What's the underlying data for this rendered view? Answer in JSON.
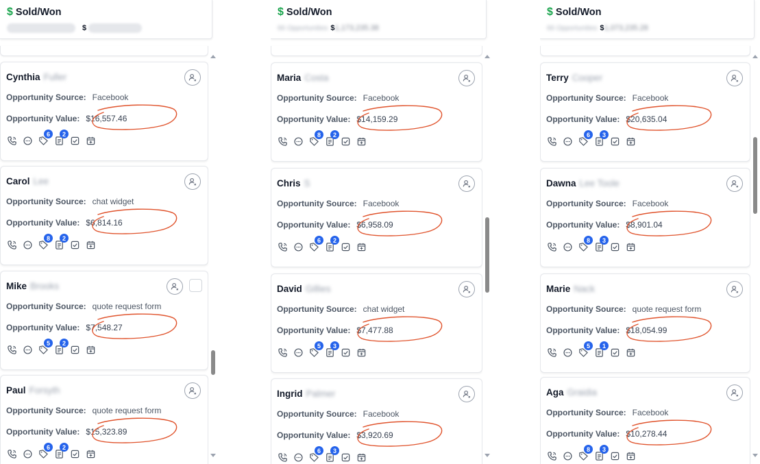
{
  "accent_color": "#2563eb",
  "annotation_color": "#e0532c",
  "labels": {
    "source": "Opportunity Source:",
    "value": "Opportunity Value:"
  },
  "columns": [
    {
      "title": "Sold/Won",
      "count_text": "",
      "amount_prefix": "$",
      "amount_blurred": "",
      "cards": [
        {
          "first_name": "Cynthia",
          "last_name": "Fuller",
          "source": "Facebook",
          "value": "$16,557.46",
          "badges": {
            "tasks": "6",
            "notes": "2"
          }
        },
        {
          "first_name": "Carol",
          "last_name": "Lee",
          "source": "chat widget",
          "value": "$6,814.16",
          "badges": {
            "tasks": "8",
            "notes": "2"
          }
        },
        {
          "first_name": "Mike",
          "last_name": "Brooks",
          "source": "quote request form",
          "value": "$7,548.27",
          "badges": {
            "tasks": "5",
            "notes": "2"
          }
        },
        {
          "first_name": "Paul",
          "last_name": "Forsyth",
          "source": "quote request form",
          "value": "$15,323.89",
          "badges": {
            "tasks": "6",
            "notes": "2"
          }
        }
      ]
    },
    {
      "title": "Sold/Won",
      "count_text": "66 Opportunities",
      "amount_prefix": "$",
      "amount_blurred": "1,173,235.38",
      "cards": [
        {
          "first_name": "Maria",
          "last_name": "Costa",
          "source": "Facebook",
          "value": "$14,159.29",
          "badges": {
            "tasks": "8",
            "notes": "2"
          }
        },
        {
          "first_name": "Chris",
          "last_name": "S",
          "source": "Facebook",
          "value": "$6,958.09",
          "badges": {
            "tasks": "6",
            "notes": "2"
          }
        },
        {
          "first_name": "David",
          "last_name": "Gillies",
          "source": "chat widget",
          "value": "$7,477.88",
          "badges": {
            "tasks": "5",
            "notes": "3"
          }
        },
        {
          "first_name": "Ingrid",
          "last_name": "Palmer",
          "source": "Facebook",
          "value": "$3,920.69",
          "badges": {
            "tasks": "6",
            "notes": "3"
          }
        }
      ]
    },
    {
      "title": "Sold/Won",
      "count_text": "66 Opportunities",
      "amount_prefix": "$",
      "amount_blurred": "1,073,235.28",
      "cards": [
        {
          "first_name": "Terry",
          "last_name": "Cooper",
          "source": "Facebook",
          "value": "$20,635.04",
          "badges": {
            "tasks": "6",
            "notes": "3"
          }
        },
        {
          "first_name": "Dawna",
          "last_name": "Lee Toole",
          "source": "Facebook",
          "value": "$8,901.04",
          "badges": {
            "tasks": "8",
            "notes": "3"
          }
        },
        {
          "first_name": "Marie",
          "last_name": "Nack",
          "source": "quote request form",
          "value": "$18,054.99",
          "badges": {
            "tasks": "5",
            "notes": "1"
          }
        },
        {
          "first_name": "Aga",
          "last_name": "Graidia",
          "source": "Facebook",
          "value": "$10,278.44",
          "badges": {
            "tasks": "8",
            "notes": "3"
          }
        }
      ]
    }
  ]
}
